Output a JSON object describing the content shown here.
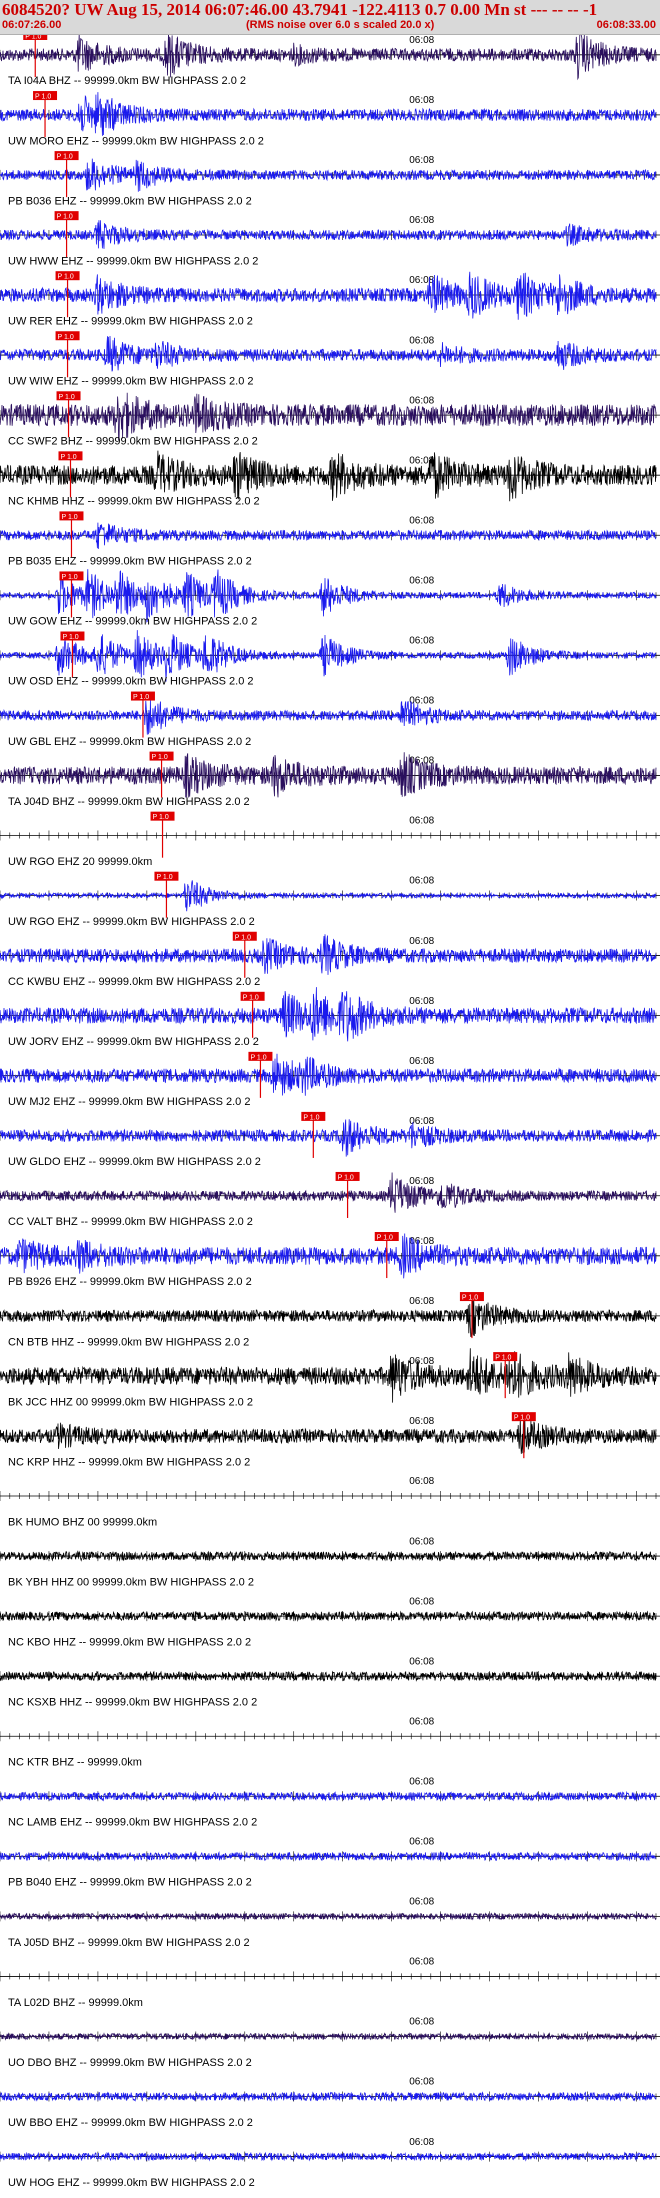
{
  "header": {
    "title": "6084520? UW Aug 15, 2014 06:07:46.00   43.7941 -122.4113  0.7 0.00 Mn st --- -- --  -1",
    "start_time": "06:07:26.00",
    "scale_note": "(RMS noise over 6.0 s scaled 20.0 x)",
    "end_time": "06:08:33.00",
    "title_color": "#cc0000"
  },
  "chart_data": {
    "type": "seismogram",
    "time_range": [
      "06:07:26.00",
      "06:08:33.00"
    ],
    "minute_mark": "06:08",
    "pick_label": "P 1.0",
    "grid": true,
    "traces": [
      {
        "label": "TA I04A BHZ -- 99999.0km BW  HIGHPASS  2.0  2",
        "color": "#2a0f5e",
        "pick_time": 3.6,
        "amplitude": 0.32,
        "bursts": [
          [
            8,
            0.8
          ],
          [
            17,
            1.0
          ],
          [
            30,
            0.3
          ],
          [
            59,
            1.0
          ]
        ]
      },
      {
        "label": "UW MORO EHZ -- 99999.0km BW  HIGHPASS  2.0  2",
        "color": "#1a1aee",
        "pick_time": 4.6,
        "amplitude": 0.3,
        "bursts": [
          [
            8,
            0.9
          ],
          [
            10,
            0.7
          ]
        ]
      },
      {
        "label": "PB B036 EHZ -- 99999.0km BW  HIGHPASS  2.0  2",
        "color": "#1a1aee",
        "pick_time": 6.8,
        "amplitude": 0.25,
        "bursts": [
          [
            9,
            0.8
          ],
          [
            14,
            0.6
          ]
        ]
      },
      {
        "label": "UW HWW EHZ -- 99999.0km BW  HIGHPASS  2.0  2",
        "color": "#1a1aee",
        "pick_time": 6.8,
        "amplitude": 0.25,
        "bursts": [
          [
            10,
            0.6
          ],
          [
            58,
            0.4
          ]
        ]
      },
      {
        "label": "UW RER EHZ -- 99999.0km BW  HIGHPASS  2.0  2",
        "color": "#1a1aee",
        "pick_time": 6.9,
        "amplitude": 0.35,
        "bursts": [
          [
            10,
            0.8
          ],
          [
            44,
            0.9
          ],
          [
            48,
            0.9
          ],
          [
            53,
            1.0
          ],
          [
            57,
            0.8
          ]
        ]
      },
      {
        "label": "UW WIW EHZ -- 99999.0km BW  HIGHPASS  2.0  2",
        "color": "#1a1aee",
        "pick_time": 6.9,
        "amplitude": 0.3,
        "bursts": [
          [
            11,
            0.8
          ],
          [
            16,
            0.5
          ],
          [
            45,
            0.4
          ],
          [
            57,
            0.6
          ]
        ]
      },
      {
        "label": "CC SWF2 BHZ -- 99999.0km BW  HIGHPASS  2.0  2",
        "color": "#2a0f5e",
        "pick_time": 7.0,
        "amplitude": 0.55,
        "bursts": [
          [
            12,
            1.0
          ],
          [
            20,
            0.6
          ]
        ]
      },
      {
        "label": "NC KHMB HHZ -- 99999.0km BW  HIGHPASS  2.0  2",
        "color": "#000000",
        "pick_time": 7.2,
        "amplitude": 0.5,
        "bursts": [
          [
            16,
            0.8
          ],
          [
            24,
            0.9
          ],
          [
            34,
            0.9
          ],
          [
            44,
            0.9
          ],
          [
            52,
            0.9
          ]
        ]
      },
      {
        "label": "PB B035 EHZ -- 99999.0km BW  HIGHPASS  2.0  2",
        "color": "#1a1aee",
        "pick_time": 7.3,
        "amplitude": 0.25,
        "bursts": [
          [
            10,
            0.6
          ]
        ]
      },
      {
        "label": "UW GOW EHZ -- 99999.0km BW  HIGHPASS  2.0  2",
        "color": "#1a1aee",
        "pick_time": 7.3,
        "amplitude": 0.15,
        "bursts": [
          [
            6,
            1.0
          ],
          [
            9,
            1.0
          ],
          [
            12,
            1.0
          ],
          [
            15,
            1.0
          ],
          [
            19,
            1.0
          ],
          [
            22,
            1.0
          ],
          [
            33,
            1.0
          ],
          [
            51,
            0.6
          ]
        ]
      },
      {
        "label": "UW OSD EHZ -- 99999.0km BW  HIGHPASS  2.0  2",
        "color": "#1a1aee",
        "pick_time": 7.4,
        "amplitude": 0.15,
        "bursts": [
          [
            6,
            1.0
          ],
          [
            10,
            1.0
          ],
          [
            14,
            1.0
          ],
          [
            17,
            1.0
          ],
          [
            21,
            1.0
          ],
          [
            33,
            1.0
          ],
          [
            52,
            1.0
          ]
        ]
      },
      {
        "label": "UW GBL EHZ -- 99999.0km BW  HIGHPASS  2.0  2",
        "color": "#1a1aee",
        "pick_time": 14.6,
        "amplitude": 0.25,
        "bursts": [
          [
            15,
            0.9
          ],
          [
            41,
            0.7
          ]
        ]
      },
      {
        "label": "TA J04D BHZ -- 99999.0km BW  HIGHPASS  2.0  2",
        "color": "#2a0f5e",
        "pick_time": 16.5,
        "amplitude": 0.45,
        "bursts": [
          [
            19,
            0.8
          ],
          [
            28,
            0.8
          ],
          [
            41,
            0.9
          ]
        ]
      },
      {
        "label": "UW RGO EHZ 20 99999.0km",
        "color": "#1a1aee",
        "pick_time": 16.6,
        "amplitude": 0.0,
        "bursts": []
      },
      {
        "label": "UW RGO EHZ -- 99999.0km BW  HIGHPASS  2.0  2",
        "color": "#1a1aee",
        "pick_time": 17.0,
        "amplitude": 0.12,
        "bursts": [
          [
            19,
            0.9
          ]
        ]
      },
      {
        "label": "CC KWBU EHZ -- 99999.0km BW  HIGHPASS  2.0  2",
        "color": "#1a1aee",
        "pick_time": 25.0,
        "amplitude": 0.35,
        "bursts": [
          [
            27,
            0.7
          ],
          [
            33,
            0.8
          ]
        ]
      },
      {
        "label": "UW JORV EHZ -- 99999.0km BW  HIGHPASS  2.0  2",
        "color": "#1a1aee",
        "pick_time": 25.8,
        "amplitude": 0.4,
        "bursts": [
          [
            29,
            1.0
          ],
          [
            32,
            1.0
          ],
          [
            35,
            1.0
          ]
        ]
      },
      {
        "label": "UW MJ2 EHZ -- 99999.0km BW  HIGHPASS  2.0  2",
        "color": "#1a1aee",
        "pick_time": 26.6,
        "amplitude": 0.35,
        "bursts": [
          [
            28,
            1.0
          ],
          [
            31,
            0.6
          ]
        ]
      },
      {
        "label": "UW GLDO EHZ -- 99999.0km BW  HIGHPASS  2.0  2",
        "color": "#1a1aee",
        "pick_time": 32.0,
        "amplitude": 0.3,
        "bursts": [
          [
            35,
            0.9
          ],
          [
            42,
            0.5
          ]
        ]
      },
      {
        "label": "CC VALT BHZ -- 99999.0km BW  HIGHPASS  2.0  2",
        "color": "#2a0f5e",
        "pick_time": 35.5,
        "amplitude": 0.25,
        "bursts": [
          [
            40,
            1.0
          ],
          [
            45,
            0.6
          ]
        ]
      },
      {
        "label": "PB B926 EHZ -- 99999.0km BW  HIGHPASS  2.0  2",
        "color": "#1a1aee",
        "pick_time": 39.5,
        "amplitude": 0.45,
        "bursts": [
          [
            41,
            0.8
          ],
          [
            2,
            0.6
          ],
          [
            8,
            0.5
          ]
        ]
      },
      {
        "label": "CN BTB HHZ -- 99999.0km BW  HIGHPASS  2.0  2",
        "color": "#000000",
        "pick_time": 48.2,
        "amplitude": 0.3,
        "bursts": [
          [
            48,
            0.9
          ]
        ]
      },
      {
        "label": "BK JCC HHZ 00 99999.0km BW  HIGHPASS  2.0  2",
        "color": "#000000",
        "pick_time": 51.6,
        "amplitude": 0.45,
        "bursts": [
          [
            40,
            1.0
          ],
          [
            48,
            1.0
          ],
          [
            52,
            1.0
          ],
          [
            58,
            0.8
          ]
        ]
      },
      {
        "label": "NC KRP HHZ -- 99999.0km BW  HIGHPASS  2.0  2",
        "color": "#000000",
        "pick_time": 53.5,
        "amplitude": 0.35,
        "bursts": [
          [
            53,
            0.8
          ],
          [
            6,
            0.4
          ]
        ]
      },
      {
        "label": "BK HUMO BHZ 00 99999.0km",
        "color": "#000000",
        "pick_time": null,
        "amplitude": 0.0,
        "bursts": []
      },
      {
        "label": "BK YBH HHZ 00 99999.0km BW  HIGHPASS  2.0  2",
        "color": "#000000",
        "pick_time": null,
        "amplitude": 0.22,
        "bursts": []
      },
      {
        "label": "NC KBO HHZ -- 99999.0km BW  HIGHPASS  2.0  2",
        "color": "#000000",
        "pick_time": null,
        "amplitude": 0.22,
        "bursts": []
      },
      {
        "label": "NC KSXB HHZ -- 99999.0km BW  HIGHPASS  2.0  2",
        "color": "#000000",
        "pick_time": null,
        "amplitude": 0.22,
        "bursts": []
      },
      {
        "label": "NC KTR BHZ -- 99999.0km",
        "color": "#000000",
        "pick_time": null,
        "amplitude": 0.0,
        "bursts": []
      },
      {
        "label": "NC LAMB EHZ -- 99999.0km BW  HIGHPASS  2.0  2",
        "color": "#1a1aee",
        "pick_time": null,
        "amplitude": 0.2,
        "bursts": []
      },
      {
        "label": "PB B040 EHZ -- 99999.0km BW  HIGHPASS  2.0  2",
        "color": "#1a1aee",
        "pick_time": null,
        "amplitude": 0.2,
        "bursts": []
      },
      {
        "label": "TA J05D BHZ -- 99999.0km BW  HIGHPASS  2.0  2",
        "color": "#2a0f5e",
        "pick_time": null,
        "amplitude": 0.15,
        "bursts": []
      },
      {
        "label": "TA L02D BHZ -- 99999.0km",
        "color": "#2a0f5e",
        "pick_time": null,
        "amplitude": 0.0,
        "bursts": []
      },
      {
        "label": "UO DBO BHZ -- 99999.0km BW  HIGHPASS  2.0  2",
        "color": "#2a0f5e",
        "pick_time": null,
        "amplitude": 0.15,
        "bursts": []
      },
      {
        "label": "UW BBO EHZ -- 99999.0km BW  HIGHPASS  2.0  2",
        "color": "#1a1aee",
        "pick_time": null,
        "amplitude": 0.2,
        "bursts": []
      },
      {
        "label": "UW HOG EHZ -- 99999.0km BW  HIGHPASS  2.0  2",
        "color": "#1a1aee",
        "pick_time": null,
        "amplitude": 0.18,
        "bursts": []
      }
    ]
  }
}
